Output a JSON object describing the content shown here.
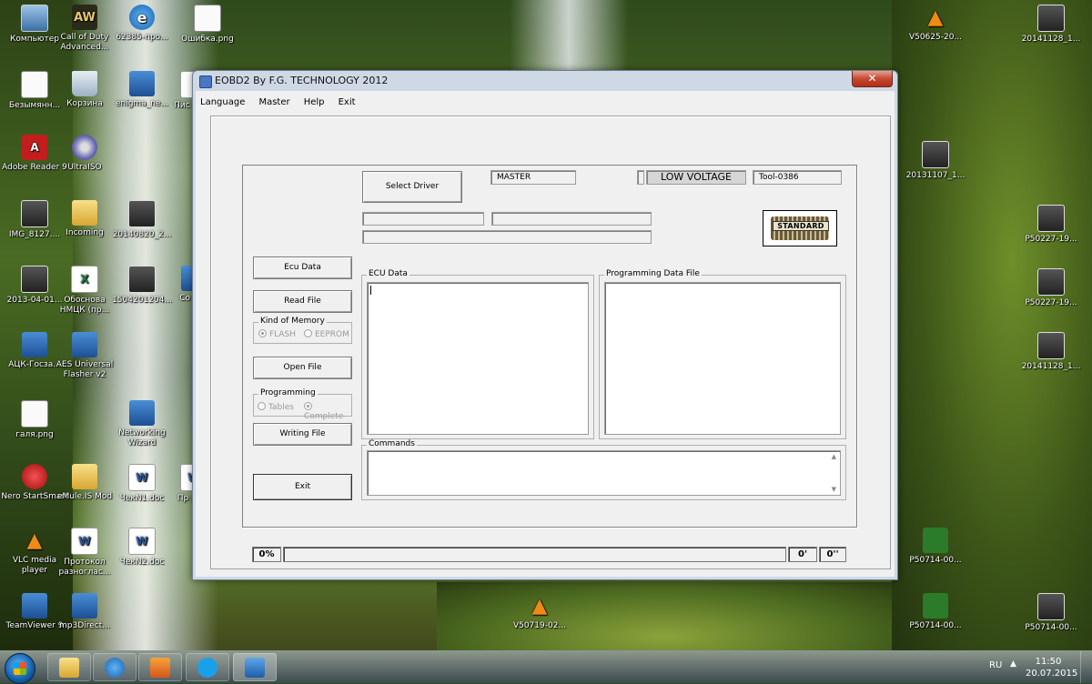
{
  "window": {
    "title": "EOBD2 By F.G. TECHNOLOGY 2012",
    "close": "✕"
  },
  "menu": [
    "Language",
    "Master",
    "Help",
    "Exit"
  ],
  "buttons": {
    "select_driver": "Select Driver",
    "ecu_data": "Ecu Data",
    "read_file": "Read File",
    "open_file": "Open File",
    "writing_file": "Writing File",
    "exit": "Exit"
  },
  "status": {
    "master": "MASTER",
    "low_voltage": "LOW VOLTAGE",
    "tool": "Tool-0386",
    "standard": "STANDARD"
  },
  "kind_of_memory": {
    "label": "Kind of Memory",
    "options": [
      "FLASH",
      "EEPROM"
    ],
    "selected": "FLASH"
  },
  "programming": {
    "label": "Programming",
    "options": [
      "Tables",
      "Complete"
    ],
    "selected": "Complete"
  },
  "panels": {
    "ecu_data": "ECU Data",
    "programming_data_file": "Programming Data File",
    "commands": "Commands"
  },
  "progress": {
    "percent": "0%",
    "minutes": "0'",
    "seconds": "0''"
  },
  "desktop_icons": [
    {
      "label": "Компьютер",
      "icon": "computer-icon"
    },
    {
      "label": "Call of Duty Advanced...",
      "icon": "game-icon"
    },
    {
      "label": "62385-про...",
      "icon": "ie-icon"
    },
    {
      "label": "Ошибка.png",
      "icon": "image-icon"
    },
    {
      "label": "Безымянн...",
      "icon": "image-icon"
    },
    {
      "label": "Корзина",
      "icon": "recycle-bin-icon"
    },
    {
      "label": "enigma_ne...",
      "icon": "app-icon"
    },
    {
      "label": "Пис пред",
      "icon": "doc-icon"
    },
    {
      "label": "Adobe Reader 9",
      "icon": "pdf-icon"
    },
    {
      "label": "UltraISO",
      "icon": "cd-icon"
    },
    {
      "label": "IMG_8127....",
      "icon": "photo-icon"
    },
    {
      "label": "Incoming",
      "icon": "folder-icon"
    },
    {
      "label": "20140820_2...",
      "icon": "photo-icon"
    },
    {
      "label": "2013-04-01...",
      "icon": "photo-icon"
    },
    {
      "label": "Обоснова НМЦК (пр...",
      "icon": "excel-icon"
    },
    {
      "label": "1504201204...",
      "icon": "photo-icon"
    },
    {
      "label": "Co Ima",
      "icon": "app-icon"
    },
    {
      "label": "АЦК-Госза...",
      "icon": "app-icon"
    },
    {
      "label": "AES Universal Flasher v2",
      "icon": "app-icon"
    },
    {
      "label": "галя.png",
      "icon": "image-icon"
    },
    {
      "label": "Networking Wizard",
      "icon": "app-icon"
    },
    {
      "label": "Nero StartSmart",
      "icon": "nero-icon"
    },
    {
      "label": "eMule.IS Mod",
      "icon": "emule-icon"
    },
    {
      "label": "ЧекN1.doc",
      "icon": "word-icon"
    },
    {
      "label": "Пр расс",
      "icon": "word-icon"
    },
    {
      "label": "VLC media player",
      "icon": "vlc-icon"
    },
    {
      "label": "Протокол разноглас...",
      "icon": "word-icon"
    },
    {
      "label": "ЧекN2.doc",
      "icon": "word-icon"
    },
    {
      "label": "TeamViewer 9",
      "icon": "teamviewer-icon"
    },
    {
      "label": "mp3Direct...",
      "icon": "app-icon"
    },
    {
      "label": "V50719-02...",
      "icon": "vlc-icon"
    },
    {
      "label": "V50625-20...",
      "icon": "vlc-icon"
    },
    {
      "label": "20141128_1...",
      "icon": "photo-icon"
    },
    {
      "label": "20131107_1...",
      "icon": "photo-icon"
    },
    {
      "label": "P50227-19...",
      "icon": "photo-icon"
    },
    {
      "label": "P50227-19...",
      "icon": "photo-icon"
    },
    {
      "label": "20141128_1...",
      "icon": "photo-icon"
    },
    {
      "label": "P50714-00...",
      "icon": "video-icon"
    },
    {
      "label": "P50714-00...",
      "icon": "video-icon"
    },
    {
      "label": "P50714-00...",
      "icon": "photo-icon"
    }
  ],
  "taskbar": {
    "lang": "RU",
    "time": "11:50",
    "date": "20.07.2015",
    "apps": [
      "explorer-icon",
      "ie-icon",
      "media-player-icon",
      "skype-icon",
      "teamviewer-icon"
    ]
  }
}
